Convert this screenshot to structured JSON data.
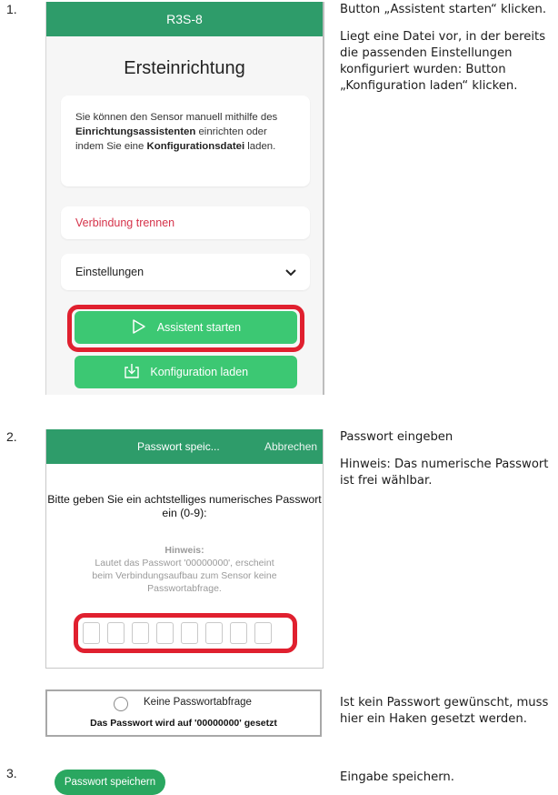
{
  "steps": [
    {
      "number": "1.",
      "screen": {
        "title": "R3S-8",
        "heading": "Ersteinrichtung",
        "info_pre": "Sie können den Sensor manuell mithilfe des ",
        "info_bold1": "Einrichtungsassistenten",
        "info_mid": " einrichten oder indem Sie eine ",
        "info_bold2": "Konfigurationsdatei",
        "info_post": " laden.",
        "disconnect_label": "Verbindung trennen",
        "settings_label": "Einstellungen",
        "start_assistant_label": "Assistent starten",
        "load_config_label": "Konfiguration laden"
      },
      "note_lines": [
        "Button „Assistent starten“ klicken.",
        "Liegt eine Datei vor, in der bereits die passenden Einstellungen konfiguriert wurden: Button „Konfiguration laden“ klicken."
      ]
    },
    {
      "number": "2.",
      "screen": {
        "title": "Passwort speic...",
        "cancel_label": "Abbrechen",
        "prompt": "Bitte geben Sie ein achtstelliges numerisches Passwort ein (0-9):",
        "hint_title": "Hinweis:",
        "hint_text": "Lautet das Passwort '00000000', erscheint beim Verbindungsaufbau zum Sensor keine Passwortabfrage.",
        "pin_digit_count": 8
      },
      "note_lines": [
        "Passwort eingeben",
        "Hinweis: Das numerische Passwort ist frei wählbar."
      ],
      "checkbox_panel": {
        "label": "Keine Passwortabfrage",
        "subtext": "Das Passwort wird auf '00000000' gesetzt",
        "checked": false
      },
      "checkbox_note": "Ist kein Passwort gewünscht, muss hier ein Haken gesetzt werden."
    },
    {
      "number": "3.",
      "save_button_label": "Passwort speichern",
      "note_lines": [
        "Eingabe speichern."
      ]
    }
  ],
  "colors": {
    "header_green": "#2e9c6a",
    "button_green": "#3cc873",
    "highlight_red": "#e0202f",
    "disconnect_red": "#d5334a"
  }
}
